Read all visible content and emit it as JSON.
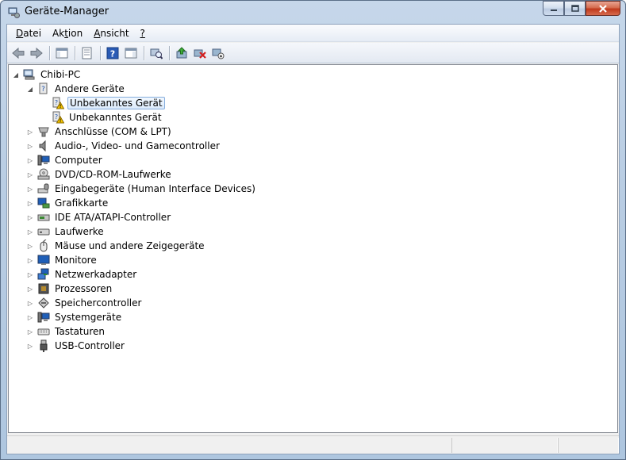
{
  "window": {
    "title": "Geräte-Manager",
    "controls": {
      "minimize": "–",
      "maximize": "□",
      "close": "✕"
    }
  },
  "menu": [
    {
      "label_underlined": "D",
      "label_rest": "atei"
    },
    {
      "label_pre": "Ak",
      "label_underlined": "t",
      "label_rest": "ion"
    },
    {
      "label_underlined": "A",
      "label_rest": "nsicht"
    },
    {
      "label_underlined": "?",
      "label_rest": ""
    }
  ],
  "toolbar_icons": [
    "back-arrow-icon",
    "forward-arrow-icon",
    "show-hide-console-tree-icon",
    "properties-icon",
    "help-icon",
    "action-pane-icon",
    "scan-hardware-icon",
    "update-driver-icon",
    "uninstall-icon",
    "disable-device-icon"
  ],
  "tree": {
    "root": "Chibi-PC",
    "items": [
      {
        "label": "Andere Geräte",
        "icon": "unknown-device-category-icon",
        "expanded": true
      },
      {
        "label": "Unbekanntes Gerät",
        "icon": "unknown-device-warning-icon",
        "selected": true
      },
      {
        "label": "Unbekanntes Gerät",
        "icon": "unknown-device-warning-icon"
      },
      {
        "label": "Anschlüsse (COM & LPT)",
        "icon": "port-icon"
      },
      {
        "label": "Audio-, Video- und Gamecontroller",
        "icon": "speaker-icon"
      },
      {
        "label": "Computer",
        "icon": "computer-icon"
      },
      {
        "label": "DVD/CD-ROM-Laufwerke",
        "icon": "dvd-drive-icon"
      },
      {
        "label": "Eingabegeräte (Human Interface Devices)",
        "icon": "hid-icon"
      },
      {
        "label": "Grafikkarte",
        "icon": "display-adapter-icon"
      },
      {
        "label": "IDE ATA/ATAPI-Controller",
        "icon": "ide-controller-icon"
      },
      {
        "label": "Laufwerke",
        "icon": "disk-drive-icon"
      },
      {
        "label": "Mäuse und andere Zeigegeräte",
        "icon": "mouse-icon"
      },
      {
        "label": "Monitore",
        "icon": "monitor-icon"
      },
      {
        "label": "Netzwerkadapter",
        "icon": "network-adapter-icon"
      },
      {
        "label": "Prozessoren",
        "icon": "processor-icon"
      },
      {
        "label": "Speichercontroller",
        "icon": "storage-controller-icon"
      },
      {
        "label": "Systemgeräte",
        "icon": "system-devices-icon"
      },
      {
        "label": "Tastaturen",
        "icon": "keyboard-icon"
      },
      {
        "label": "USB-Controller",
        "icon": "usb-icon"
      }
    ]
  },
  "colors": {
    "selection_border": "#84acdd",
    "window_frame": "#b9cde3",
    "close_button": "#c0391c",
    "warning": "#f5c400"
  }
}
